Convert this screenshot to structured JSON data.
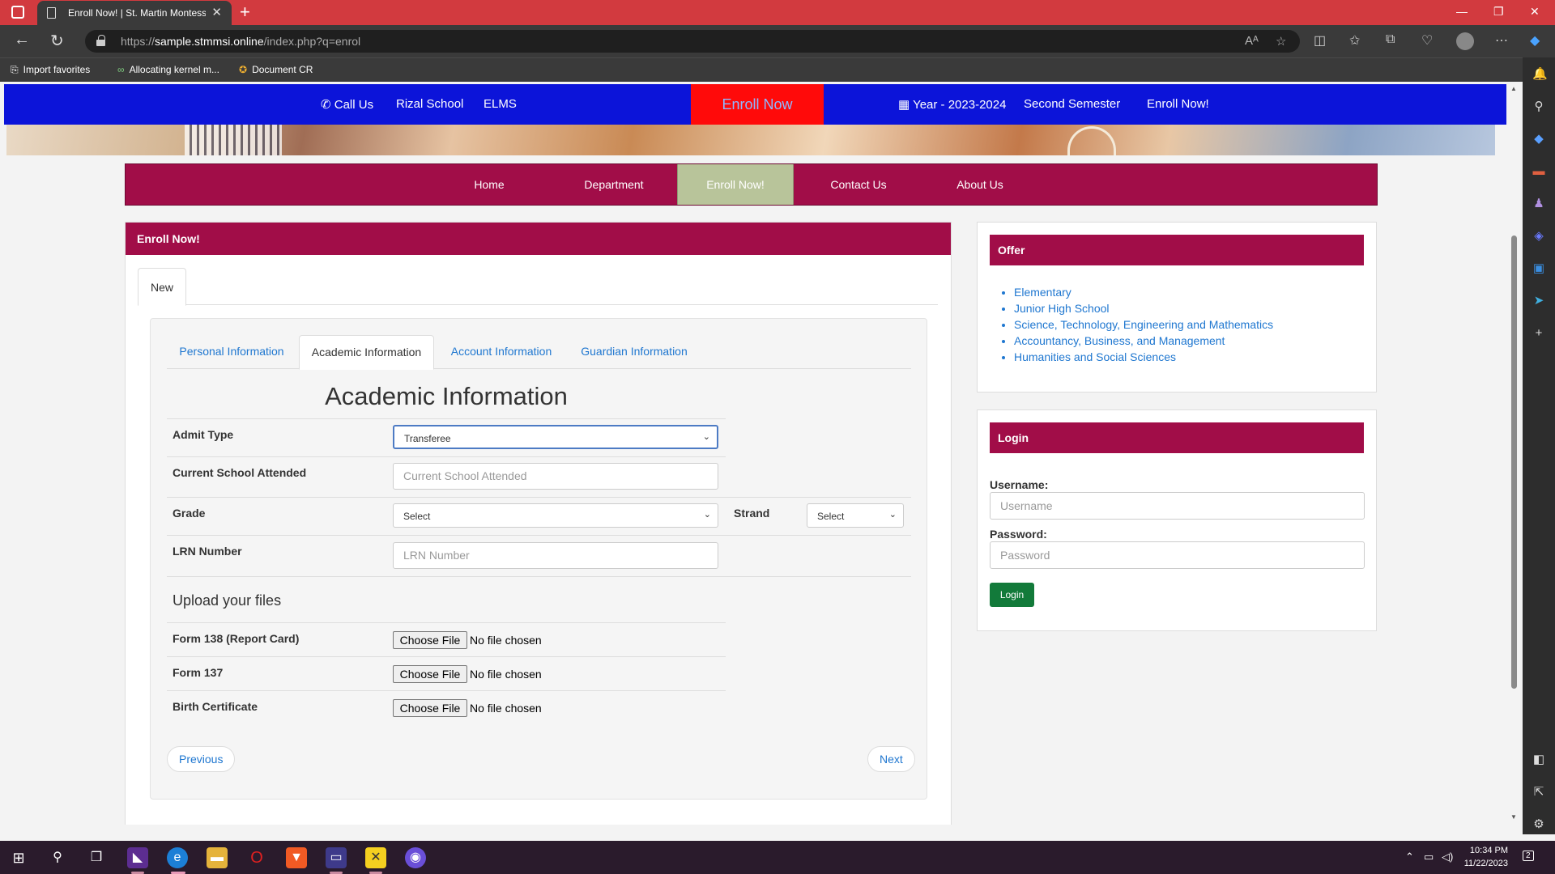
{
  "browser": {
    "tab_title": "Enroll Now! | St. Martin Montess",
    "url_prefix": "https://",
    "url_host": "sample.stmmsi.online",
    "url_path": "/index.php?q=enrol",
    "favorites": [
      "Import favorites",
      "Allocating kernel m...",
      "Document CR"
    ]
  },
  "topnav": {
    "call_us": "Call Us",
    "rizal_school": "Rizal School",
    "elms": "ELMS",
    "enroll_now": "Enroll Now",
    "year": "Year - 2023-2024",
    "semester": "Second Semester",
    "enroll_now_right": "Enroll Now!"
  },
  "menu": {
    "items": [
      "Home",
      "Department",
      "Enroll Now!",
      "Contact Us",
      "About Us"
    ],
    "active": "Enroll Now!"
  },
  "main_panel": {
    "heading": "Enroll Now!",
    "tab_new": "New",
    "wizard_tabs": [
      "Personal Information",
      "Academic Information",
      "Account Information",
      "Guardian Information"
    ],
    "active_wizard_tab": "Academic Information",
    "form_title": "Academic Information",
    "fields": {
      "admit_type": {
        "label": "Admit Type",
        "value": "Transferee"
      },
      "current_school": {
        "label": "Current School Attended",
        "placeholder": "Current School Attended"
      },
      "grade": {
        "label": "Grade",
        "value": "Select"
      },
      "strand": {
        "label": "Strand",
        "value": "Select"
      },
      "lrn": {
        "label": "LRN Number",
        "placeholder": "LRN Number"
      }
    },
    "upload_title": "Upload your files",
    "uploads": [
      {
        "label": "Form 138 (Report Card)",
        "button": "Choose File",
        "status": "No file chosen"
      },
      {
        "label": "Form 137",
        "button": "Choose File",
        "status": "No file chosen"
      },
      {
        "label": "Birth Certificate",
        "button": "Choose File",
        "status": "No file chosen"
      }
    ],
    "previous": "Previous",
    "next": "Next"
  },
  "offer_panel": {
    "heading": "Offer",
    "items": [
      "Elementary",
      "Junior High School",
      "Science, Technology, Engineering and Mathematics",
      "Accountancy, Business, and Management",
      "Humanities and Social Sciences"
    ]
  },
  "login_panel": {
    "heading": "Login",
    "username_label": "Username:",
    "username_placeholder": "Username",
    "password_label": "Password:",
    "password_placeholder": "Password",
    "button": "Login"
  },
  "taskbar": {
    "time": "10:34 PM",
    "date": "11/22/2023",
    "notification_count": "2"
  },
  "colors": {
    "maroon": "#a10d48",
    "nav_blue": "#0c14d9",
    "enroll_red": "#ff0a0a",
    "active_menu": "#b8c49a",
    "link_blue": "#1f77d0",
    "login_green": "#127a3a"
  }
}
